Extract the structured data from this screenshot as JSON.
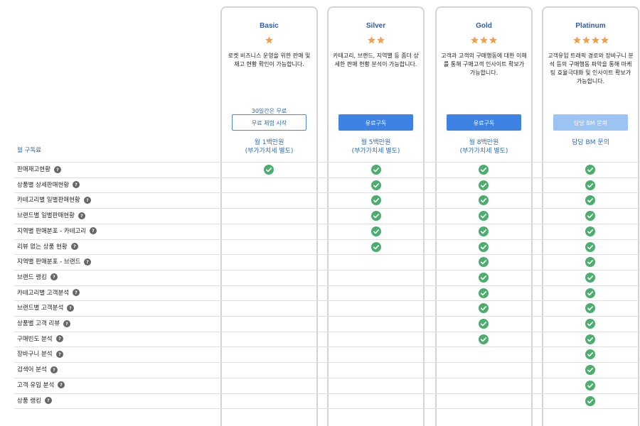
{
  "fee_row_label": "월 구독료",
  "plans": [
    {
      "name": "Basic",
      "stars": 1,
      "description": "로켓 비즈니스 운영을 위한 판매 및 재고 현황 확인이 가능합니다.",
      "trial_note": "30일간은 무료",
      "button_label": "무료 체험 시작",
      "price_line1": "월 1백만원",
      "price_line2": "(부가가치세 별도)"
    },
    {
      "name": "Silver",
      "stars": 2,
      "description": "카테고리, 브랜드, 지역별 등 좀더 상세한 판매 현황 분석이 가능합니다.",
      "trial_note": "",
      "button_label": "유료구독",
      "price_line1": "월 5백만원",
      "price_line2": "(부가가치세 별도)"
    },
    {
      "name": "Gold",
      "stars": 3,
      "description": "고객과 고객의 구매행동에 대한 이해를 통해 구매고객 인사이트 확보가 가능합니다.",
      "trial_note": "",
      "button_label": "유료구독",
      "price_line1": "월 8백만원",
      "price_line2": "(부가가치세 별도)"
    },
    {
      "name": "Platinum",
      "stars": 4,
      "description": "고객유입 트래픽 경로와 장바구니 분석 등의 구매행동 파악을 통해 마케팅 효율극대화 및 인사이트 확보가 가능합니다.",
      "trial_note": "",
      "button_label": "담당 BM 문의",
      "price_line1": "담당 BM 문의",
      "price_line2": ""
    }
  ],
  "features": [
    {
      "label": "판매재고현황",
      "plans": [
        true,
        true,
        true,
        true
      ]
    },
    {
      "label": "상품별 상세판매현황",
      "plans": [
        false,
        true,
        true,
        true
      ]
    },
    {
      "label": "카테고리별 일별판매현황",
      "plans": [
        false,
        true,
        true,
        true
      ]
    },
    {
      "label": "브랜드별 일별판매현황",
      "plans": [
        false,
        true,
        true,
        true
      ]
    },
    {
      "label": "지역별 판매분포 - 카테고리",
      "plans": [
        false,
        true,
        true,
        true
      ]
    },
    {
      "label": "리뷰 없는 상품 현황",
      "plans": [
        false,
        true,
        true,
        true
      ]
    },
    {
      "label": "지역별 판매분포 - 브랜드",
      "plans": [
        false,
        false,
        true,
        true
      ]
    },
    {
      "label": "브랜드 랭킹",
      "plans": [
        false,
        false,
        true,
        true
      ]
    },
    {
      "label": "카테고리별 고객분석",
      "plans": [
        false,
        false,
        true,
        true
      ]
    },
    {
      "label": "브랜드별 고객분석",
      "plans": [
        false,
        false,
        true,
        true
      ]
    },
    {
      "label": "상품별 고객 리뷰",
      "plans": [
        false,
        false,
        true,
        true
      ]
    },
    {
      "label": "구매빈도 분석",
      "plans": [
        false,
        false,
        true,
        true
      ]
    },
    {
      "label": "장바구니 분석",
      "plans": [
        false,
        false,
        false,
        true
      ]
    },
    {
      "label": "검색어 분석",
      "plans": [
        false,
        false,
        false,
        true
      ]
    },
    {
      "label": "고객 유입 분석",
      "plans": [
        false,
        false,
        false,
        true
      ]
    },
    {
      "label": "상품 랭킹",
      "plans": [
        false,
        false,
        false,
        true
      ]
    }
  ],
  "colors": {
    "star": "#f0a24a",
    "check": "#4cae6e",
    "accent": "#3e83e4",
    "accent_light": "#9cc4f2",
    "link": "#2f6db5"
  },
  "icons": {
    "star": "star-icon",
    "check": "check-circle-icon",
    "help": "help-circle-icon"
  }
}
